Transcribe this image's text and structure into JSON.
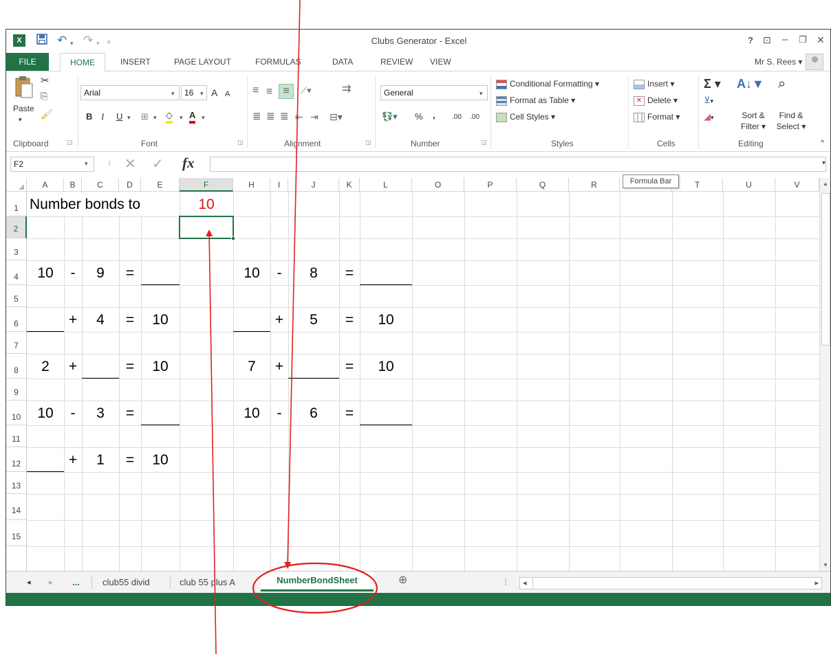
{
  "window": {
    "title": "Clubs Generator - Excel",
    "help": "?",
    "restore_ribbon": "⊡",
    "minimize": "–",
    "maximize": "❐",
    "close": "✕"
  },
  "qat": {
    "save_icon": "save-icon",
    "undo": "↶",
    "undo_dd": "▾",
    "redo": "↷",
    "redo_dd": "▾",
    "customize": "⩡"
  },
  "ribbon_tabs": {
    "file": "FILE",
    "home": "HOME",
    "insert": "INSERT",
    "page_layout": "PAGE LAYOUT",
    "formulas": "FORMULAS",
    "data": "DATA",
    "review": "REVIEW",
    "view": "VIEW"
  },
  "user": {
    "name": "Mr S. Rees ▾"
  },
  "ribbon": {
    "clipboard": {
      "paste": "Paste",
      "label": "Clipboard"
    },
    "font": {
      "name": "Arial",
      "size": "16",
      "bold": "B",
      "italic": "I",
      "underline": "U",
      "grow": "A",
      "shrink": "A",
      "label": "Font"
    },
    "alignment": {
      "label": "Alignment"
    },
    "number": {
      "format": "General",
      "percent": "%",
      "comma": ",",
      "inc_dec": ".00",
      "label": "Number"
    },
    "styles": {
      "conditional": "Conditional Formatting ▾",
      "as_table": "Format as Table ▾",
      "cell_styles": "Cell Styles ▾",
      "label": "Styles"
    },
    "cells": {
      "insert": "Insert ▾",
      "delete": "Delete ▾",
      "format": "Format ▾",
      "label": "Cells"
    },
    "editing": {
      "autosum": "Σ ▾",
      "fill": "▾",
      "clear": "▾",
      "sort_filter": "Sort &\nFilter ▾",
      "find_select": "Find &\nSelect ▾",
      "label": "Editing",
      "collapse": "^"
    }
  },
  "formula_bar": {
    "name_box": "F2",
    "fx": "fx",
    "cancel": "✕",
    "enter": "✓",
    "tooltip": "Formula Bar"
  },
  "grid": {
    "columns": [
      "A",
      "B",
      "C",
      "D",
      "E",
      "F",
      "H",
      "I",
      "J",
      "K",
      "L",
      "O",
      "P",
      "Q",
      "R",
      "S",
      "T",
      "U",
      "V"
    ],
    "rows": [
      "1",
      "2",
      "3",
      "4",
      "5",
      "6",
      "7",
      "8",
      "9",
      "10",
      "11",
      "12",
      "13",
      "14",
      "15"
    ],
    "title": "Number bonds to",
    "target": "10",
    "r4": {
      "a": "10",
      "b": "-",
      "c": "9",
      "d": "=",
      "h": "10",
      "i": "-",
      "j": "8",
      "k": "="
    },
    "r6": {
      "b": "+",
      "c": "4",
      "d": "=",
      "e": "10",
      "i": "+",
      "j": "5",
      "k": "=",
      "l": "10"
    },
    "r8": {
      "a": "2",
      "b": "+",
      "d": "=",
      "e": "10",
      "h": "7",
      "i": "+",
      "k": "=",
      "l": "10"
    },
    "r10": {
      "a": "10",
      "b": "-",
      "c": "3",
      "d": "=",
      "h": "10",
      "i": "-",
      "j": "6",
      "k": "="
    },
    "r12": {
      "b": "+",
      "c": "1",
      "d": "=",
      "e": "10"
    }
  },
  "sheet_tabs": {
    "prev": "◂",
    "next": "▸",
    "more": "...",
    "t1": "club55 divid",
    "t2": "club 55 plus A",
    "active": "NumberBondSheet",
    "add": "⊕",
    "split": "⁝",
    "hs_left": "◂",
    "hs_right": "▸"
  },
  "colors": {
    "excel_green": "#217346",
    "annotation_red": "#e02020"
  }
}
